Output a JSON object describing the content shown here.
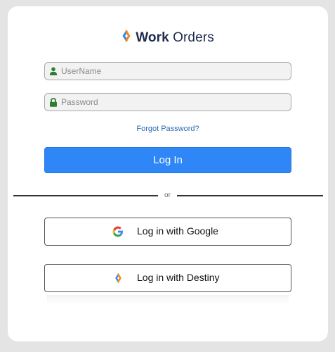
{
  "brand": {
    "name_bold": "Work",
    "name_rest": " Orders",
    "logo_icon": "work-orders-logo-icon",
    "colors": {
      "blue": "#2f86f6",
      "orange": "#f28a1a",
      "navy": "#1d2b4f"
    }
  },
  "form": {
    "username": {
      "placeholder": "UserName",
      "value": "",
      "icon": "user-icon",
      "icon_color": "#2e7d32"
    },
    "password": {
      "placeholder": "Password",
      "value": "",
      "icon": "lock-icon",
      "icon_color": "#2e7d32"
    },
    "forgot_label": "Forgot Password?",
    "login_label": "Log In"
  },
  "divider": {
    "label": "or"
  },
  "sso": {
    "google": {
      "label": "Log in with Google",
      "icon": "google-icon"
    },
    "destiny": {
      "label": "Log in with Destiny",
      "icon": "destiny-icon"
    }
  }
}
